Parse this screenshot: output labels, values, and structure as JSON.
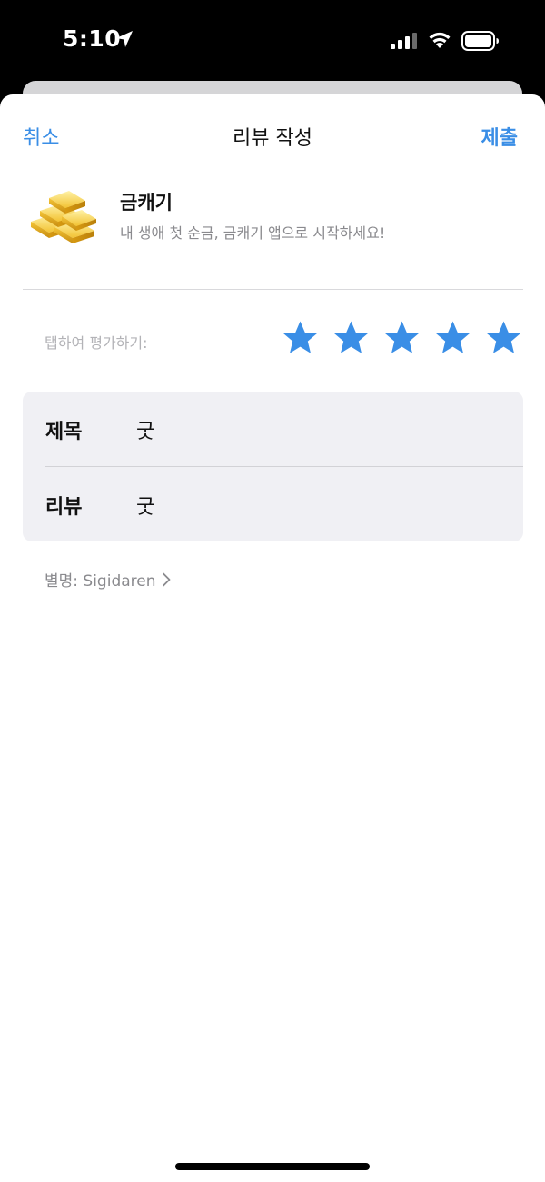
{
  "status_bar": {
    "time": "5:10",
    "icons": [
      "location-arrow-icon",
      "cellular-signal-icon",
      "wifi-icon",
      "battery-icon"
    ]
  },
  "nav": {
    "cancel_label": "취소",
    "title": "리뷰 작성",
    "submit_label": "제출"
  },
  "app": {
    "name": "금캐기",
    "subtitle": "내 생애 첫 순금, 금캐기 앱으로 시작하세요!",
    "icon": "gold-bars-icon"
  },
  "rating": {
    "prompt": "탭하여 평가하기:",
    "value": 5,
    "max": 5
  },
  "form": {
    "title_label": "제목",
    "title_value": "굿",
    "review_label": "리뷰",
    "review_value": "굿"
  },
  "nickname": {
    "text": "별명: Sigidaren"
  },
  "colors": {
    "accent": "#3a8ee6",
    "star": "#3a8ee6",
    "secondary_text": "#8a8a8e",
    "card_background": "#f0f0f4"
  }
}
